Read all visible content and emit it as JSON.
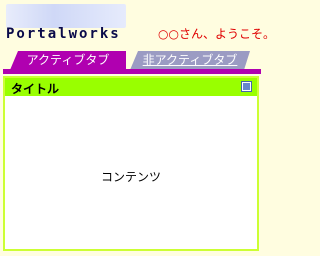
{
  "header": {
    "logo_text": "Portalworks",
    "welcome": "○○さん、ようこそ。"
  },
  "tabs": [
    {
      "label": "アクティブタブ",
      "state": "active"
    },
    {
      "label": "非アクティブタブ",
      "state": "inactive"
    }
  ],
  "panel": {
    "title": "タイトル",
    "icon": "window-restore-icon",
    "content": "コンテンツ"
  },
  "colors": {
    "background": "#fffde0",
    "active_tab": "#b000b0",
    "inactive_tab": "#9b9bc3",
    "panel_header": "#99ff00",
    "welcome_text": "#e00000"
  }
}
